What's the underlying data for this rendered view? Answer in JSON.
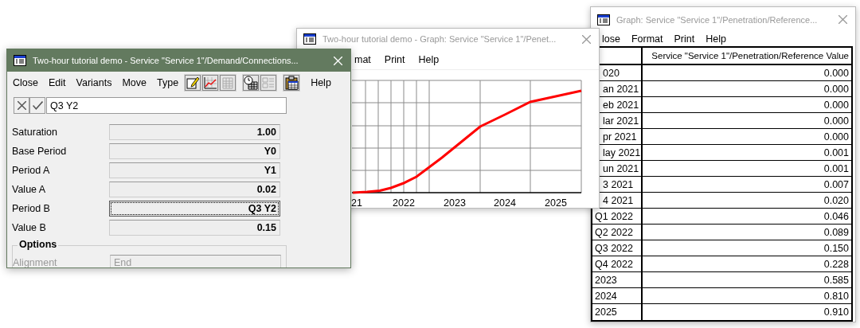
{
  "table_window": {
    "title": "Graph: Service \"Service 1\"/Penetration/Reference...",
    "menu": [
      "lose",
      "Format",
      "Print",
      "Help"
    ],
    "header": "Service \"Service 1\"/Penetration/Reference Value",
    "rows": [
      {
        "period": "020",
        "value": "0.000"
      },
      {
        "period": "an 2021",
        "value": "0.000"
      },
      {
        "period": "eb 2021",
        "value": "0.000"
      },
      {
        "period": "lar 2021",
        "value": "0.000"
      },
      {
        "period": "pr 2021",
        "value": "0.000"
      },
      {
        "period": "lay 2021",
        "value": "0.001"
      },
      {
        "period": "un 2021",
        "value": "0.001"
      },
      {
        "period": "3 2021",
        "value": "0.007"
      },
      {
        "period": "4 2021",
        "value": "0.020"
      },
      {
        "period": "Q1 2022",
        "value": "0.046"
      },
      {
        "period": "Q2 2022",
        "value": "0.089"
      },
      {
        "period": "Q3 2022",
        "value": "0.150"
      },
      {
        "period": "Q4 2022",
        "value": "0.228"
      },
      {
        "period": "2023",
        "value": "0.585"
      },
      {
        "period": "2024",
        "value": "0.810"
      },
      {
        "period": "2025",
        "value": "0.910"
      }
    ]
  },
  "graph_window": {
    "title": "Two-hour tutorial demo  - Graph: Service \"Service 1\"/Penet...",
    "menu": [
      "mat",
      "Print",
      "Help"
    ],
    "x_labels": [
      "21",
      "2022",
      "2023",
      "2024",
      "2025"
    ]
  },
  "service_window": {
    "title": "Two-hour tutorial demo  - Service \"Service 1\"/Demand/Connections...",
    "menu": [
      "Close",
      "Edit",
      "Variants",
      "Move",
      "Type",
      "Help"
    ],
    "input_value": "Q3 Y2",
    "fields": [
      {
        "label": "Saturation",
        "value": "1.00",
        "focused": false
      },
      {
        "label": "Base Period",
        "value": "Y0",
        "focused": false
      },
      {
        "label": "Period A",
        "value": "Y1",
        "focused": false
      },
      {
        "label": "Value A",
        "value": "0.02",
        "focused": false
      },
      {
        "label": "Period B",
        "value": "Q3 Y2",
        "focused": true
      },
      {
        "label": "Value B",
        "value": "0.15",
        "focused": false
      }
    ],
    "options": {
      "title": "Options",
      "fields": [
        {
          "label": "Alignment",
          "value": "End"
        }
      ]
    }
  }
}
